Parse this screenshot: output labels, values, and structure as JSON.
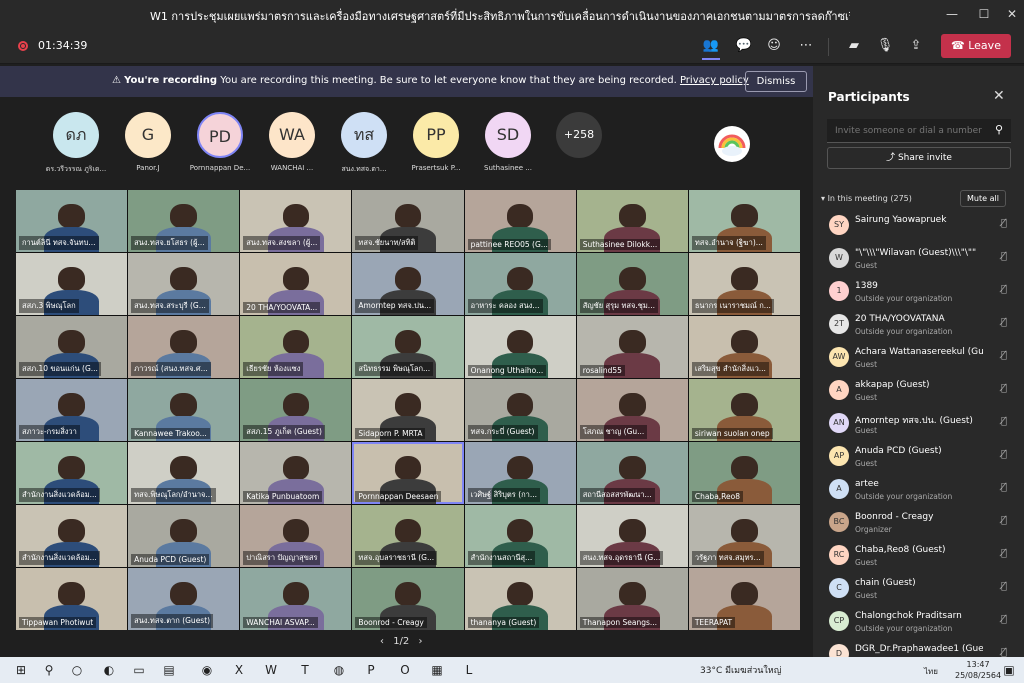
{
  "window": {
    "title": "W1 การประชุมเผยแพร่มาตรการและเครื่องมือทางเศรษฐศาสตร์ที่มีประสิทธิภาพในการขับเคลื่อนการดำเนินงานของภาคเอกชนตามมาตรการลดก๊าซเรือนกระจก (ภาครัฐ)",
    "min": "—",
    "max": "☐",
    "close": "✕"
  },
  "topbar": {
    "timer": "01:34:39",
    "leave_label": "Leave",
    "icons": [
      "people-icon",
      "chat-icon",
      "reactions-icon",
      "more-icon",
      "camera-off-icon",
      "mic-off-icon",
      "share-icon"
    ]
  },
  "banner": {
    "bold": "You're recording",
    "message": "You are recording this meeting. Be sure to let everyone know that they are being recorded.",
    "link": "Privacy policy",
    "dismiss": "Dismiss"
  },
  "avatars": [
    {
      "initials": "ดภ",
      "name": "ดร.วรีวรรณ ภูริเด...",
      "color": "#c9e7ee"
    },
    {
      "initials": "G",
      "name": "Panor.J",
      "color": "#fce8c8"
    },
    {
      "initials": "PD",
      "name": "Pornnappan De...",
      "color": "#f5d3d9"
    },
    {
      "initials": "WA",
      "name": "WANCHAI ...",
      "color": "#fde5c9"
    },
    {
      "initials": "ทส",
      "name": "สนง.ทสจ.ตา...",
      "color": "#cfe0f5"
    },
    {
      "initials": "PP",
      "name": "Prasertsuk P...",
      "color": "#fbeaa8"
    },
    {
      "initials": "SD",
      "name": "Suthasinee ...",
      "color": "#f1d7f4"
    }
  ],
  "more_count": "+258",
  "tiles": [
    "กานต์ลินี ทสจ.จันทบ...",
    "สนง.ทสจ.ยโสธร (ผู้...",
    "สนง.ทสจ.สงขลา (ผู้...",
    "ทสจ.ชัยนาท/สทิติ",
    "pattinee REO05 (G...",
    "Suthasinee Dilokk...",
    "ทสจ.อำนาจ (ฐิฆา)...",
    "สสภ.3 พิษณุโลก",
    "สนง.ทสจ.สระบุรี (G...",
    "20 THA/YOOVATA...",
    "Amorntep ทสจ.ปน...",
    "อาหาระ คลอง สนง...",
    "สัญชัย สุรุม ทสจ.ชุม...",
    "ธนากร เนาราชมณ์ ก...",
    "สสภ.10 ขอนแก่น (G...",
    "ภาวรณ์ (สนง.ทสจ.ศ...",
    "เธียรชัย ห้องแซง",
    "สนิทธรรม พิษณุโลก...",
    "Onanong Uthaiho...",
    "rosalind55",
    "เสริมสุข สำนักสิ่งแว...",
    "สภาวะ-กรมสิ่งวา",
    "Kannawee Trakoo...",
    "สสภ.15 ภูเก็ต (Guest)",
    "Sidaporn P. MRTA",
    "ทสจ.กระบี่ (Guest)",
    "โสภณ ชาญ (Gu...",
    "siriwan suolan onep",
    "สำนักงานสิ่งแวดล้อม...",
    "ทสจ.พิษณุโลก/อำนาจ...",
    "Katika Punbuatoom",
    "Pornnappan Deesaen",
    "เวศิษฐ์ สิริบุตร (กา...",
    "สถานีสอสสรพัฒนา...",
    "Chaba,Reo8",
    "สำนักงานสิ่งแวดล้อม...",
    "Anuda PCD (Guest)",
    "ปาณิสรา ปัญญาสุขสร",
    "ทสจ.อุบลราชธานี (G...",
    "สำนักงานสถานีสุ...",
    "สนง.ทสจ.อุดรธานี (G...",
    "วรัฐภา ทสจ.สมุทร...",
    "Tippawan Photiwut",
    "สนง.ทสจ.ตาก (Guest)",
    "WANCHAI ASVAP...",
    "Boonrod - Creagy",
    "thananya (Guest)",
    "Thanapon Seangs...",
    "TEERAPAT"
  ],
  "pager": {
    "prev": "‹",
    "label": "1/2",
    "next": "›"
  },
  "panel": {
    "title": "Participants",
    "invite_placeholder": "Invite someone or dial a number",
    "share_invite": "Share invite",
    "in_meeting": "In this meeting (275)",
    "mute_all": "Mute all",
    "participants": [
      {
        "initials": "SY",
        "name": "Sairung Yaowapruek",
        "sub": ""
      },
      {
        "initials": "W",
        "name": "\"\\\"\\\\\\\"Wilavan (Guest)\\\\\\\"\\\"\"",
        "sub": "Guest"
      },
      {
        "initials": "1",
        "name": "1389",
        "sub": "Outside your organization"
      },
      {
        "initials": "2T",
        "name": "20 THA/YOOVATANA",
        "sub": "Outside your organization"
      },
      {
        "initials": "AW",
        "name": "Achara Wattanasereekul (Gue...",
        "sub": "Guest"
      },
      {
        "initials": "A",
        "name": "akkapap (Guest)",
        "sub": "Guest"
      },
      {
        "initials": "AN",
        "name": "Amorntep ทสจ.ปน. (Guest)",
        "sub": "Guest"
      },
      {
        "initials": "AP",
        "name": "Anuda PCD (Guest)",
        "sub": "Guest"
      },
      {
        "initials": "A",
        "name": "artee",
        "sub": "Outside your organization"
      },
      {
        "initials": "BC",
        "name": "Boonrod - Creagy",
        "sub": "Organizer"
      },
      {
        "initials": "RC",
        "name": "Chaba,Reo8 (Guest)",
        "sub": "Guest"
      },
      {
        "initials": "C",
        "name": "chain (Guest)",
        "sub": "Guest"
      },
      {
        "initials": "CP",
        "name": "Chalongchok Praditsarn",
        "sub": "Outside your organization"
      },
      {
        "initials": "D",
        "name": "DGR_Dr.Praphawadee1 (Guest)",
        "sub": "Guest"
      }
    ]
  },
  "taskbar": {
    "weather": "33°C มีเมฆส่วนใหญ่",
    "lang": "ไทย",
    "time": "13:47",
    "date": "25/08/2564"
  }
}
